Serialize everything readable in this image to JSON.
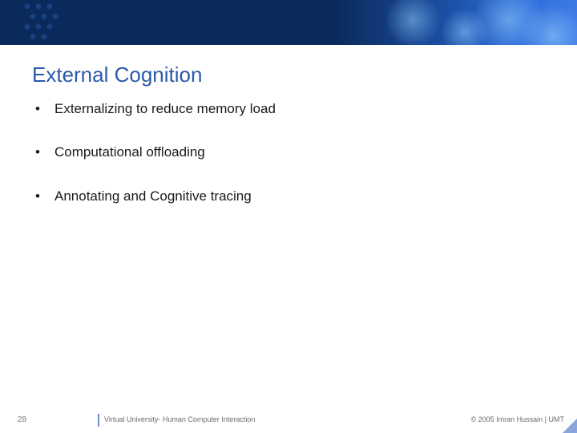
{
  "title": "External Cognition",
  "bullets": [
    "Externalizing to reduce memory load",
    "Computational offloading",
    "Annotating and Cognitive tracing"
  ],
  "slide_number": "28",
  "footer_center": "Virtual University- Human Computer Interaction",
  "footer_right": "© 2005 Imran Hussain | UMT"
}
